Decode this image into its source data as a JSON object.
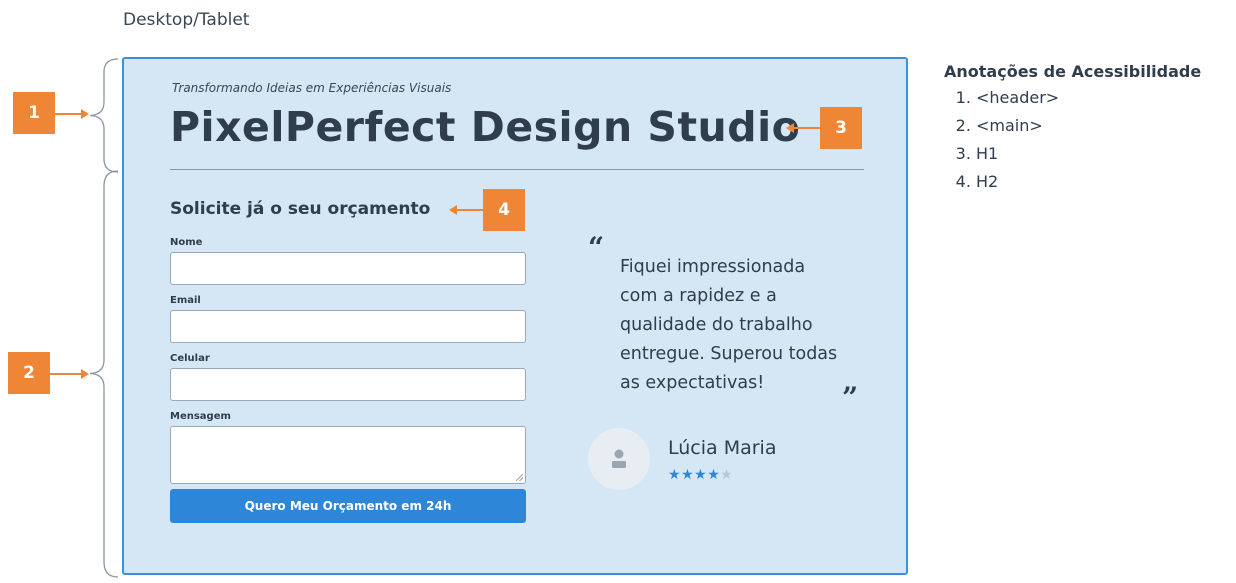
{
  "view_label": "Desktop/Tablet",
  "page": {
    "tagline": "Transformando Ideias em Experiências Visuais",
    "title": "PixelPerfect Design Studio"
  },
  "form": {
    "heading": "Solicite já o seu orçamento",
    "fields": [
      {
        "label": "Nome",
        "value": ""
      },
      {
        "label": "Email",
        "value": ""
      },
      {
        "label": "Celular",
        "value": ""
      },
      {
        "label": "Mensagem",
        "value": ""
      }
    ],
    "submit_label": "Quero Meu Orçamento em 24h"
  },
  "testimonial": {
    "open_quote": "“",
    "close_quote": "”",
    "text": "Fiquei impressionada com a rapidez e a qualidade do trabalho entregue. Superou todas as expectativas!",
    "author": "Lúcia Maria",
    "rating": 4,
    "max_rating": 5,
    "avatar_icon": "user-icon"
  },
  "badges": [
    "1",
    "2",
    "3",
    "4"
  ],
  "annotations": {
    "title": "Anotações de Acessibilidade",
    "items": [
      "<header>",
      "<main>",
      "H1",
      "H2"
    ]
  },
  "colors": {
    "badge": "#ee8635",
    "accent": "#2e86d9",
    "frame_bg": "#d5e6f5"
  }
}
